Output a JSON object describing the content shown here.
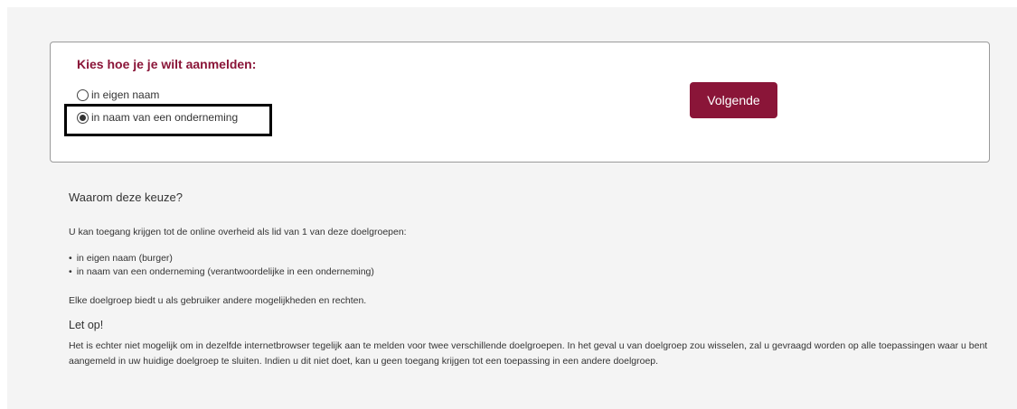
{
  "choice": {
    "title": "Kies hoe je je wilt aanmelden:",
    "options": [
      {
        "label": "in eigen naam",
        "selected": false
      },
      {
        "label": "in naam van een onderneming",
        "selected": true
      }
    ],
    "next_label": "Volgende",
    "accent_color": "#8a1538"
  },
  "info": {
    "heading": "Waarom deze keuze?",
    "intro": "U kan toegang krijgen tot de online overheid als lid van 1 van deze doelgroepen:",
    "groups": [
      "in eigen naam (burger)",
      "in naam van een onderneming (verantwoordelijke in een onderneming)"
    ],
    "rights": "Elke doelgroep biedt u als gebruiker andere mogelijkheden en rechten.",
    "attention_heading": "Let op!",
    "attention_text": "Het is echter niet mogelijk om in dezelfde internetbrowser tegelijk aan te melden voor twee verschillende doelgroepen. In het geval u van doelgroep zou wisselen, zal u gevraagd worden op alle toepassingen waar u bent aangemeld in uw huidige doelgroep te sluiten. Indien u dit niet doet, kan u geen toegang krijgen tot een toepassing in een andere doelgroep."
  }
}
